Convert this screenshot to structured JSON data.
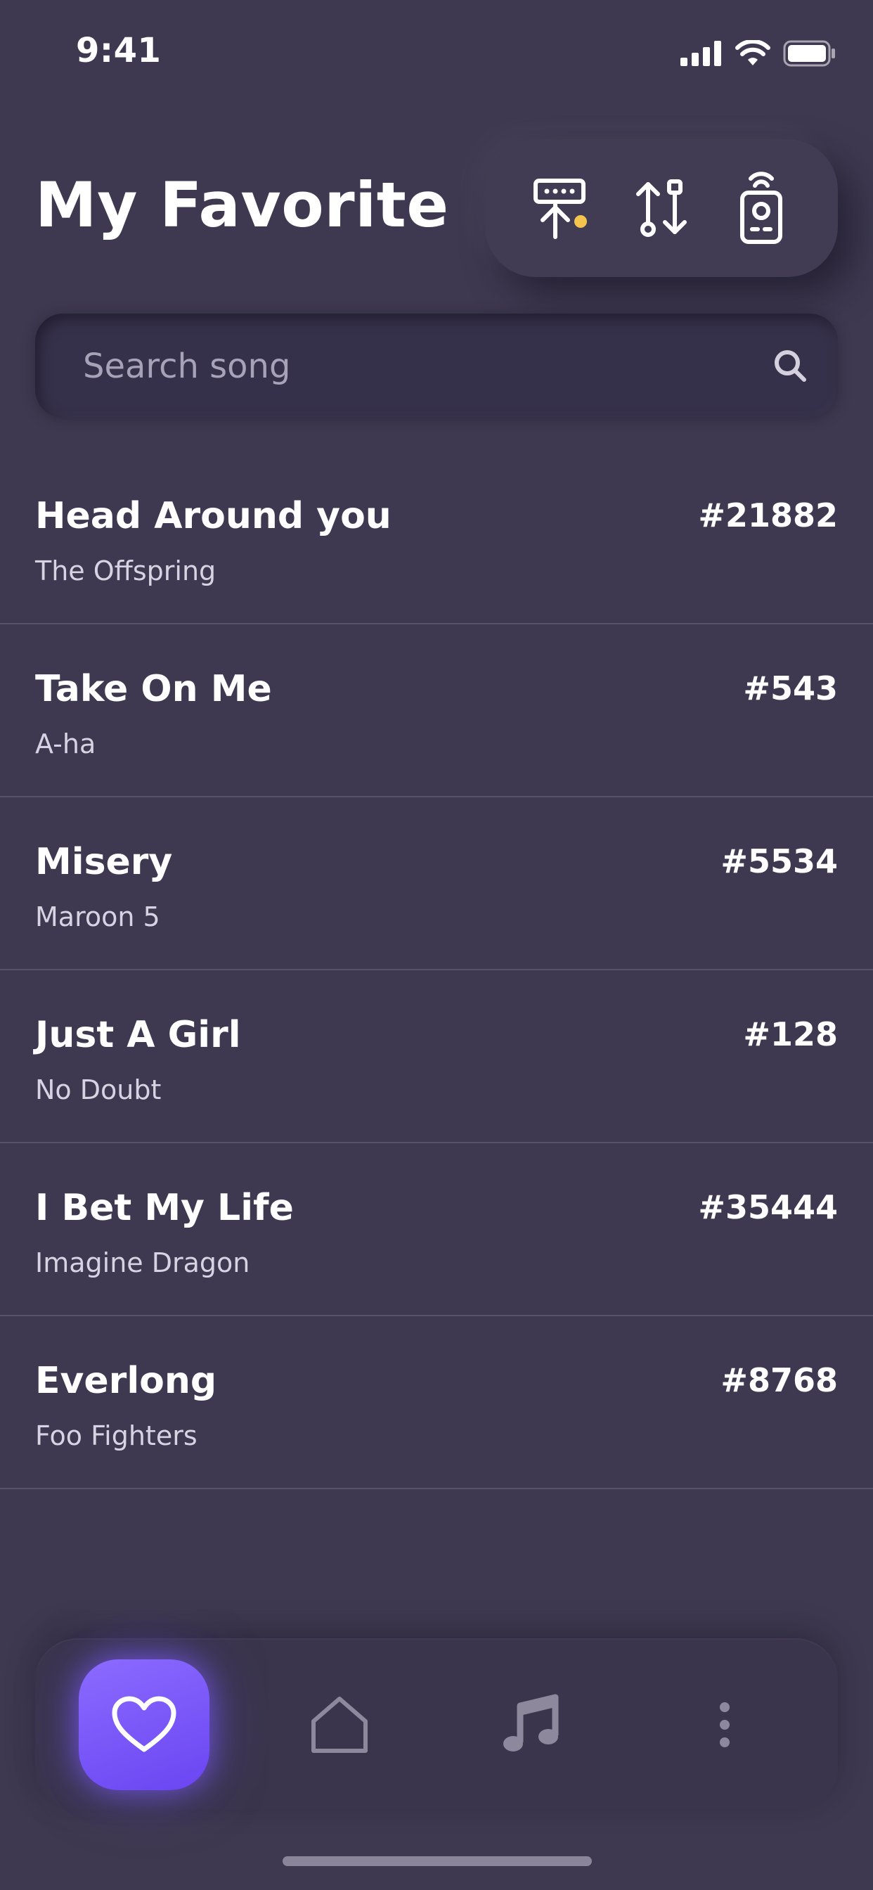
{
  "status_bar": {
    "time": "9:41"
  },
  "header": {
    "title": "My Favorite",
    "toolbar": [
      {
        "icon": "microphone-stand-icon",
        "indicator_color": "#f4c44e"
      },
      {
        "icon": "sort-arrows-icon"
      },
      {
        "icon": "remote-control-icon"
      }
    ]
  },
  "search": {
    "placeholder": "Search song",
    "value": "",
    "icon": "search-icon"
  },
  "songs": [
    {
      "title": "Head Around you",
      "artist": "The Offspring",
      "number": "#21882"
    },
    {
      "title": "Take On Me",
      "artist": "A-ha",
      "number": "#543"
    },
    {
      "title": "Misery",
      "artist": "Maroon 5",
      "number": "#5534"
    },
    {
      "title": "Just A Girl",
      "artist": "No Doubt",
      "number": "#128"
    },
    {
      "title": "I Bet My Life",
      "artist": "Imagine Dragon",
      "number": "#35444"
    },
    {
      "title": "Everlong",
      "artist": "Foo Fighters",
      "number": "#8768"
    }
  ],
  "bottom_nav": [
    {
      "icon": "heart-icon",
      "active": true
    },
    {
      "icon": "home-icon",
      "active": false
    },
    {
      "icon": "music-note-icon",
      "active": false
    },
    {
      "icon": "more-icon",
      "active": false
    }
  ],
  "colors": {
    "background": "#3e3950",
    "accent": "#7b58fb",
    "indicator": "#f4c44e"
  }
}
